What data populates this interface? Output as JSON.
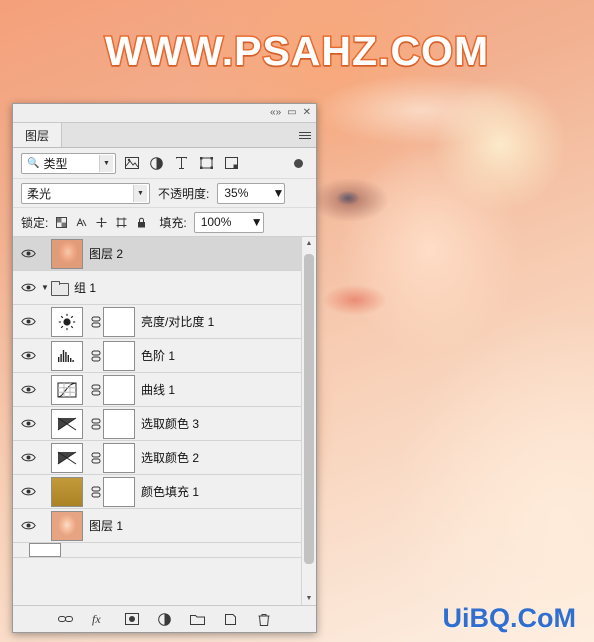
{
  "watermarks": {
    "top": "WWW.PSAHZ.COM",
    "bottom": "UiBQ.CoM"
  },
  "panel": {
    "titlebar": {
      "collapse": "«»",
      "minimize": "▭",
      "close": "✕"
    },
    "tab_label": "图层",
    "menu_icon": "panel-menu-icon",
    "filter_row": {
      "filter_type_label": "类型",
      "icons": [
        "pixel-filter-icon",
        "adjustment-filter-icon",
        "type-filter-icon",
        "shape-filter-icon",
        "smart-object-filter-icon"
      ],
      "toggle_icon": "filter-toggle-icon"
    },
    "blend_row": {
      "blend_mode": "柔光",
      "opacity_label": "不透明度:",
      "opacity_value": "35%"
    },
    "lock_row": {
      "lock_label": "锁定:",
      "lock_icons": [
        "lock-transparent-icon",
        "lock-image-icon",
        "lock-position-icon",
        "lock-artboard-icon",
        "lock-all-icon"
      ],
      "fill_label": "填充:",
      "fill_value": "100%"
    },
    "layers": [
      {
        "name": "图层 2",
        "thumb": "face",
        "selected": true,
        "visible": true,
        "indent": 0,
        "type": "pixel",
        "mask": false
      },
      {
        "name": "组 1",
        "thumb": "folder",
        "selected": false,
        "visible": true,
        "indent": 0,
        "type": "group",
        "expanded": true
      },
      {
        "name": "亮度/对比度 1",
        "thumb": "brightness",
        "selected": false,
        "visible": true,
        "indent": 1,
        "type": "adjustment",
        "mask": true
      },
      {
        "name": "色阶 1",
        "thumb": "levels",
        "selected": false,
        "visible": true,
        "indent": 1,
        "type": "adjustment",
        "mask": true
      },
      {
        "name": "曲线 1",
        "thumb": "curves",
        "selected": false,
        "visible": true,
        "indent": 1,
        "type": "adjustment",
        "mask": true
      },
      {
        "name": "选取颜色 3",
        "thumb": "selective",
        "selected": false,
        "visible": true,
        "indent": 1,
        "type": "adjustment",
        "mask": true
      },
      {
        "name": "选取颜色 2",
        "thumb": "selective",
        "selected": false,
        "visible": true,
        "indent": 1,
        "type": "adjustment",
        "mask": true
      },
      {
        "name": "颜色填充 1",
        "thumb": "gold",
        "selected": false,
        "visible": true,
        "indent": 1,
        "type": "fill",
        "mask": true
      },
      {
        "name": "图层 1",
        "thumb": "face2",
        "selected": false,
        "visible": true,
        "indent": 0,
        "type": "pixel",
        "mask": false
      }
    ],
    "bottom_bar_icons": [
      "link-layers-icon",
      "layer-style-icon",
      "add-mask-icon",
      "new-adjustment-icon",
      "new-group-icon",
      "new-layer-icon",
      "delete-layer-icon"
    ],
    "scrollbar": {
      "up": "▲",
      "down": "▼"
    }
  }
}
